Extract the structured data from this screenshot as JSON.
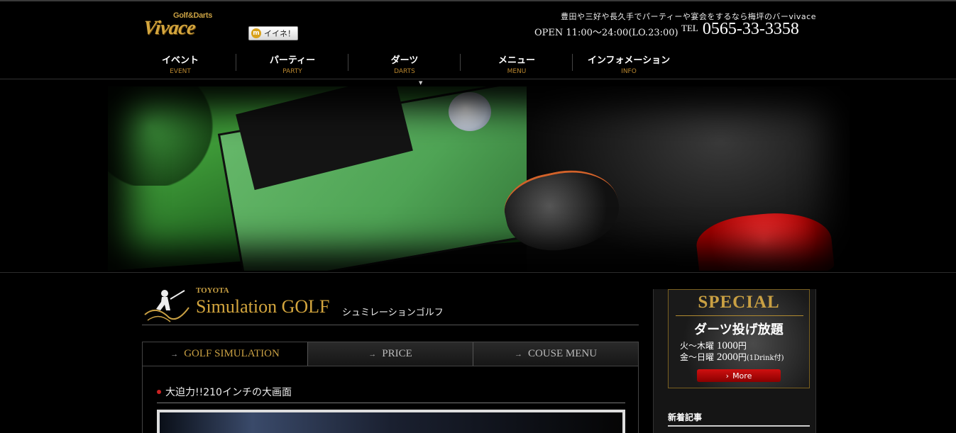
{
  "header": {
    "logo_small": "Golf&Darts",
    "logo_big": "Vivace",
    "like_button": "イイネ！",
    "tagline": "豊田や三好や長久手でパーティーや宴会をするなら梅坪のバーvivace",
    "open_hours": "OPEN 11:00〜24:00(LO.23:00)",
    "tel_label": "TEL",
    "tel_number": "0565-33-3358"
  },
  "nav": [
    {
      "jp": "イベント",
      "en": "EVENT"
    },
    {
      "jp": "パーティー",
      "en": "PARTY"
    },
    {
      "jp": "ダーツ",
      "en": "DARTS"
    },
    {
      "jp": "メニュー",
      "en": "MENU"
    },
    {
      "jp": "インフォメーション",
      "en": "INFO"
    }
  ],
  "page": {
    "kicker": "TOYOTA",
    "title": "Simulation GOLF",
    "subtitle": "シュミレーションゴルフ"
  },
  "tabs": [
    "GOLF SIMULATION",
    "PRICE",
    "COUSE MENU"
  ],
  "content": {
    "heading": "大迫力!!210インチの大画面"
  },
  "sidebar": {
    "special_title": "SPECIAL",
    "special_main": "ダーツ投げ放題",
    "line1_days": "火〜木曜",
    "line1_price": "1000",
    "line1_unit": "円",
    "line2_days": "金〜日曜",
    "line2_price": "2000",
    "line2_unit": "円",
    "line2_note": "(1Drink付)",
    "more": "More",
    "new_posts": "新着記事"
  },
  "colors": {
    "gold": "#c9a043",
    "accent_red": "#c22222",
    "background": "#000000"
  },
  "icons": [
    "chevron-right-icon",
    "golfer-icon",
    "nav-indicator-icon"
  ]
}
